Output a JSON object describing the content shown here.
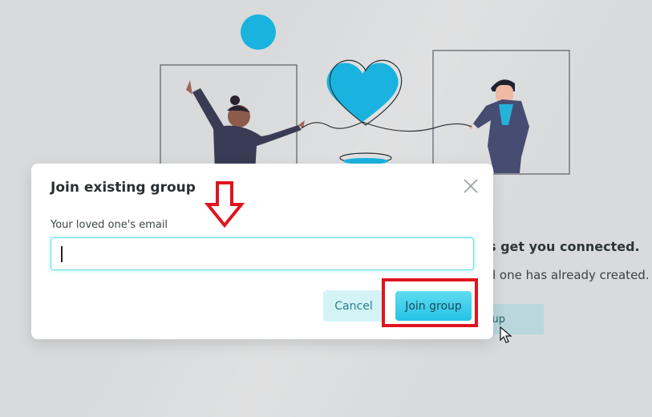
{
  "background": {
    "heading": "s get you connected.",
    "subtext": "l one has already created.",
    "button_label": "up",
    "colors": {
      "page": "#d9dadb",
      "accent": "#29b5df"
    }
  },
  "modal": {
    "title": "Join existing group",
    "email_label": "Your loved one's email",
    "email_value": "",
    "email_placeholder": "",
    "cancel_label": "Cancel",
    "join_label": "Join group",
    "close_icon": "close-icon"
  },
  "annotations": {
    "arrow_icon": "down-arrow-icon",
    "highlight_color": "#e0141f"
  }
}
